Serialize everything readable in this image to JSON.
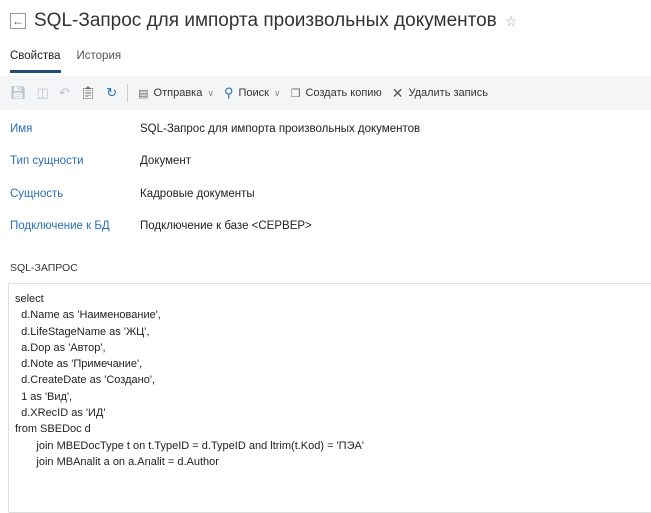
{
  "header": {
    "title": "SQL-Запрос для импорта произвольных документов",
    "back_icon": "arrow-left-icon",
    "favorite_icon": "star-icon"
  },
  "tabs": [
    {
      "label": "Свойства",
      "active": true
    },
    {
      "label": "История",
      "active": false
    }
  ],
  "toolbar": {
    "send_label": "Отправка",
    "search_label": "Поиск",
    "copy_label": "Создать копию",
    "delete_label": "Удалить запись"
  },
  "fields": [
    {
      "label": "Имя",
      "value": "SQL-Запрос для импорта произвольных документов"
    },
    {
      "label": "Тип сущности",
      "value": "Документ"
    },
    {
      "label": "Сущность",
      "value": "Кадровые документы"
    },
    {
      "label": "Подключение к БД",
      "value": "Подключение к базе <СЕРВЕР>"
    }
  ],
  "sql": {
    "label": "SQL-ЗАПРОС",
    "text": "select\n  d.Name as 'Наименование',\n  d.LifeStageName as 'ЖЦ',\n  a.Dop as 'Автор',\n  d.Note as 'Примечание',\n  d.CreateDate as 'Создано',\n  1 as 'Вид',\n  d.XRecID as 'ИД'\nfrom SBEDoc d\n       join MBEDocType t on t.TypeID = d.TypeID and ltrim(t.Kod) = 'ПЭА'\n       join MBAnalit a on a.Analit = d.Author"
  },
  "colors": {
    "label": "#2a6ebb",
    "tab_underline": "#1f4e79",
    "toolbar_bg": "#f4f5f6"
  }
}
